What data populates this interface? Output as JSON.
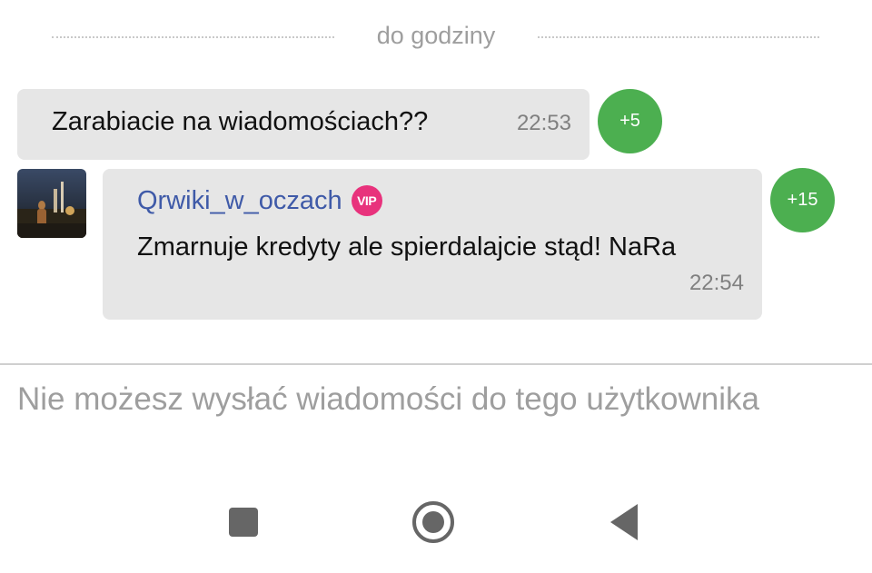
{
  "date_divider": {
    "label": "do godziny"
  },
  "messages": [
    {
      "text": "Zarabiacie na wiadomościach??",
      "time": "22:53",
      "score": "+5"
    },
    {
      "sender": "Qrwiki_w_oczach",
      "sender_badge": "VIP",
      "text": "Zmarnuje kredyty ale spierdalajcie stąd! NaRa",
      "time": "22:54",
      "score": "+15"
    }
  ],
  "composer": {
    "blocked_notice": "Nie możesz wysłać wiadomości do tego użytkownika"
  },
  "navbar": {
    "recents_icon": "square-recents-icon",
    "home_icon": "circle-home-icon",
    "back_icon": "triangle-back-icon"
  },
  "colors": {
    "bubble_bg": "#e6e6e6",
    "score_badge": "#4caf50",
    "vip_badge": "#e8327c",
    "sender_name": "#3f5aa8",
    "muted_text": "#9e9e9e"
  }
}
